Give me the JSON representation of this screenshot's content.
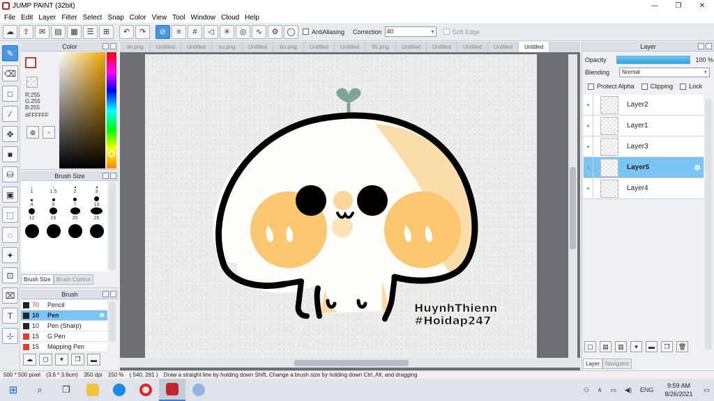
{
  "window": {
    "title": "JUMP PAINT (32bit)",
    "controls": [
      "—",
      "❐",
      "✕"
    ]
  },
  "menu": [
    "File",
    "Edit",
    "Layer",
    "Filter",
    "Select",
    "Snap",
    "Color",
    "View",
    "Tool",
    "Window",
    "Cloud",
    "Help"
  ],
  "toolbar": {
    "antialiasing_label": "AntiAliasing",
    "correction_label": "Correction",
    "correction_value": "40",
    "soft_edge_label": "Soft Edge"
  },
  "color_panel": {
    "title": "Color",
    "r": "R:255",
    "g": "G:255",
    "b": "B:255",
    "hex": "#FFFFFF",
    "accent": "#d32f2f"
  },
  "brush_size_panel": {
    "title": "Brush Size",
    "sizes": [
      "1",
      "1.5",
      "2",
      "3",
      "4",
      "5",
      "7",
      "10",
      "12",
      "15",
      "20",
      "25"
    ],
    "tabs": [
      "Brush Size",
      "Brush Control"
    ]
  },
  "brush_panel": {
    "title": "Brush",
    "items": [
      {
        "size": "70",
        "name": "Pencil",
        "color": "#222222"
      },
      {
        "size": "10",
        "name": "Pen",
        "color": "#222222"
      },
      {
        "size": "10",
        "name": "Pen (Sharp)",
        "color": "#222222"
      },
      {
        "size": "15",
        "name": "G Pen",
        "color": "#e53935"
      },
      {
        "size": "15",
        "name": "Mapping Pen",
        "color": "#e53935"
      }
    ]
  },
  "doc_tabs": [
    "on.png",
    "Untitled",
    "Untitled",
    "su.png",
    "Untitled",
    "bo.png",
    "Untitled",
    "Untitled",
    "85.png",
    "Untitled",
    "Untitled",
    "Untitled",
    "Untitled",
    "Untitled"
  ],
  "canvas": {
    "watermark_line1": "HuynhThienn",
    "watermark_line2": "#Hoidap247"
  },
  "layer_panel": {
    "title": "Layer",
    "opacity_label": "Opacity",
    "opacity_value": "100 %",
    "blending_label": "Blending",
    "blending_value": "Normal",
    "protect_alpha": "Protect Alpha",
    "clipping": "Clipping",
    "lock": "Lock",
    "layers": [
      "Layer2",
      "Layer1",
      "Layer3",
      "Layer5",
      "Layer4"
    ],
    "tabs": [
      "Layer",
      "Navigator"
    ]
  },
  "status": {
    "size": "500 * 500 pixel",
    "physical": "(3.6 * 3.6cm)",
    "dpi": "350 dpi",
    "zoom": "150 %",
    "coords": "( 540, 281 )",
    "hint": "Draw a straight line by holding down Shift, Change a brush size by holding down Ctrl, Alt, and dragging"
  },
  "taskbar": {
    "lang": "ENG",
    "time": "9:59 AM",
    "date": "8/26/2021"
  }
}
